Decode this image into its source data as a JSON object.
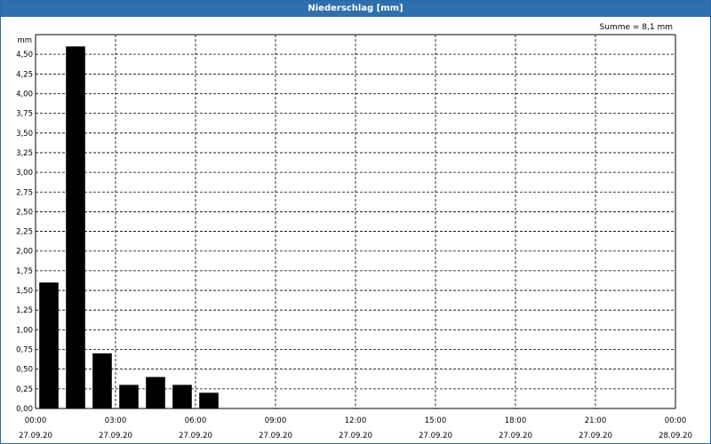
{
  "title": "Niederschlag [mm]",
  "summary": "Summe = 8,1 mm",
  "colors": {
    "titlebar": "#2f6fae",
    "bars": "#000000"
  },
  "chart_data": {
    "type": "bar",
    "title": "Niederschlag [mm]",
    "ylabel": "mm",
    "ylim": [
      0,
      4.75
    ],
    "yticks": [
      "0,00",
      "0,25",
      "0,50",
      "0,75",
      "1,00",
      "1,25",
      "1,50",
      "1,75",
      "2,00",
      "2,25",
      "2,50",
      "2,75",
      "3,00",
      "3,25",
      "3,50",
      "3,75",
      "4,00",
      "4,25",
      "4,50"
    ],
    "xlim_hours": [
      0,
      24
    ],
    "xticks": [
      {
        "time": "00:00",
        "date": "27.09.20"
      },
      {
        "time": "03:00",
        "date": "27.09.20"
      },
      {
        "time": "06:00",
        "date": "27.09.20"
      },
      {
        "time": "09:00",
        "date": "27.09.20"
      },
      {
        "time": "12:00",
        "date": "27.09.20"
      },
      {
        "time": "15:00",
        "date": "27.09.20"
      },
      {
        "time": "18:00",
        "date": "27.09.20"
      },
      {
        "time": "21:00",
        "date": "27.09.20"
      },
      {
        "time": "00:00",
        "date": "28.09.20"
      }
    ],
    "categories": [
      "00:00",
      "01:00",
      "02:00",
      "03:00",
      "04:00",
      "05:00",
      "06:00"
    ],
    "values": [
      1.6,
      4.6,
      0.7,
      0.3,
      0.4,
      0.3,
      0.2
    ],
    "grid": true,
    "grid_style": "dashed"
  }
}
